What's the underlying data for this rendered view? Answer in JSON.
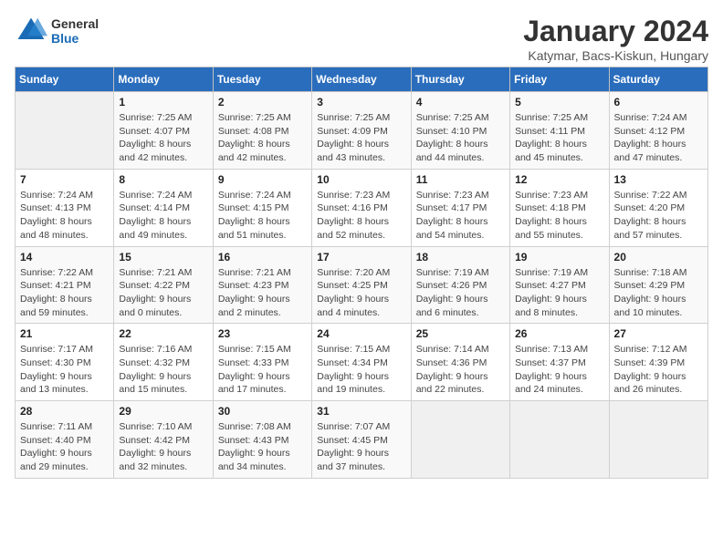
{
  "header": {
    "logo_general": "General",
    "logo_blue": "Blue",
    "main_title": "January 2024",
    "subtitle": "Katymar, Bacs-Kiskun, Hungary"
  },
  "weekdays": [
    "Sunday",
    "Monday",
    "Tuesday",
    "Wednesday",
    "Thursday",
    "Friday",
    "Saturday"
  ],
  "weeks": [
    [
      {
        "day": "",
        "sunrise": "",
        "sunset": "",
        "daylight": ""
      },
      {
        "day": "1",
        "sunrise": "Sunrise: 7:25 AM",
        "sunset": "Sunset: 4:07 PM",
        "daylight": "Daylight: 8 hours and 42 minutes."
      },
      {
        "day": "2",
        "sunrise": "Sunrise: 7:25 AM",
        "sunset": "Sunset: 4:08 PM",
        "daylight": "Daylight: 8 hours and 42 minutes."
      },
      {
        "day": "3",
        "sunrise": "Sunrise: 7:25 AM",
        "sunset": "Sunset: 4:09 PM",
        "daylight": "Daylight: 8 hours and 43 minutes."
      },
      {
        "day": "4",
        "sunrise": "Sunrise: 7:25 AM",
        "sunset": "Sunset: 4:10 PM",
        "daylight": "Daylight: 8 hours and 44 minutes."
      },
      {
        "day": "5",
        "sunrise": "Sunrise: 7:25 AM",
        "sunset": "Sunset: 4:11 PM",
        "daylight": "Daylight: 8 hours and 45 minutes."
      },
      {
        "day": "6",
        "sunrise": "Sunrise: 7:24 AM",
        "sunset": "Sunset: 4:12 PM",
        "daylight": "Daylight: 8 hours and 47 minutes."
      }
    ],
    [
      {
        "day": "7",
        "sunrise": "Sunrise: 7:24 AM",
        "sunset": "Sunset: 4:13 PM",
        "daylight": "Daylight: 8 hours and 48 minutes."
      },
      {
        "day": "8",
        "sunrise": "Sunrise: 7:24 AM",
        "sunset": "Sunset: 4:14 PM",
        "daylight": "Daylight: 8 hours and 49 minutes."
      },
      {
        "day": "9",
        "sunrise": "Sunrise: 7:24 AM",
        "sunset": "Sunset: 4:15 PM",
        "daylight": "Daylight: 8 hours and 51 minutes."
      },
      {
        "day": "10",
        "sunrise": "Sunrise: 7:23 AM",
        "sunset": "Sunset: 4:16 PM",
        "daylight": "Daylight: 8 hours and 52 minutes."
      },
      {
        "day": "11",
        "sunrise": "Sunrise: 7:23 AM",
        "sunset": "Sunset: 4:17 PM",
        "daylight": "Daylight: 8 hours and 54 minutes."
      },
      {
        "day": "12",
        "sunrise": "Sunrise: 7:23 AM",
        "sunset": "Sunset: 4:18 PM",
        "daylight": "Daylight: 8 hours and 55 minutes."
      },
      {
        "day": "13",
        "sunrise": "Sunrise: 7:22 AM",
        "sunset": "Sunset: 4:20 PM",
        "daylight": "Daylight: 8 hours and 57 minutes."
      }
    ],
    [
      {
        "day": "14",
        "sunrise": "Sunrise: 7:22 AM",
        "sunset": "Sunset: 4:21 PM",
        "daylight": "Daylight: 8 hours and 59 minutes."
      },
      {
        "day": "15",
        "sunrise": "Sunrise: 7:21 AM",
        "sunset": "Sunset: 4:22 PM",
        "daylight": "Daylight: 9 hours and 0 minutes."
      },
      {
        "day": "16",
        "sunrise": "Sunrise: 7:21 AM",
        "sunset": "Sunset: 4:23 PM",
        "daylight": "Daylight: 9 hours and 2 minutes."
      },
      {
        "day": "17",
        "sunrise": "Sunrise: 7:20 AM",
        "sunset": "Sunset: 4:25 PM",
        "daylight": "Daylight: 9 hours and 4 minutes."
      },
      {
        "day": "18",
        "sunrise": "Sunrise: 7:19 AM",
        "sunset": "Sunset: 4:26 PM",
        "daylight": "Daylight: 9 hours and 6 minutes."
      },
      {
        "day": "19",
        "sunrise": "Sunrise: 7:19 AM",
        "sunset": "Sunset: 4:27 PM",
        "daylight": "Daylight: 9 hours and 8 minutes."
      },
      {
        "day": "20",
        "sunrise": "Sunrise: 7:18 AM",
        "sunset": "Sunset: 4:29 PM",
        "daylight": "Daylight: 9 hours and 10 minutes."
      }
    ],
    [
      {
        "day": "21",
        "sunrise": "Sunrise: 7:17 AM",
        "sunset": "Sunset: 4:30 PM",
        "daylight": "Daylight: 9 hours and 13 minutes."
      },
      {
        "day": "22",
        "sunrise": "Sunrise: 7:16 AM",
        "sunset": "Sunset: 4:32 PM",
        "daylight": "Daylight: 9 hours and 15 minutes."
      },
      {
        "day": "23",
        "sunrise": "Sunrise: 7:15 AM",
        "sunset": "Sunset: 4:33 PM",
        "daylight": "Daylight: 9 hours and 17 minutes."
      },
      {
        "day": "24",
        "sunrise": "Sunrise: 7:15 AM",
        "sunset": "Sunset: 4:34 PM",
        "daylight": "Daylight: 9 hours and 19 minutes."
      },
      {
        "day": "25",
        "sunrise": "Sunrise: 7:14 AM",
        "sunset": "Sunset: 4:36 PM",
        "daylight": "Daylight: 9 hours and 22 minutes."
      },
      {
        "day": "26",
        "sunrise": "Sunrise: 7:13 AM",
        "sunset": "Sunset: 4:37 PM",
        "daylight": "Daylight: 9 hours and 24 minutes."
      },
      {
        "day": "27",
        "sunrise": "Sunrise: 7:12 AM",
        "sunset": "Sunset: 4:39 PM",
        "daylight": "Daylight: 9 hours and 26 minutes."
      }
    ],
    [
      {
        "day": "28",
        "sunrise": "Sunrise: 7:11 AM",
        "sunset": "Sunset: 4:40 PM",
        "daylight": "Daylight: 9 hours and 29 minutes."
      },
      {
        "day": "29",
        "sunrise": "Sunrise: 7:10 AM",
        "sunset": "Sunset: 4:42 PM",
        "daylight": "Daylight: 9 hours and 32 minutes."
      },
      {
        "day": "30",
        "sunrise": "Sunrise: 7:08 AM",
        "sunset": "Sunset: 4:43 PM",
        "daylight": "Daylight: 9 hours and 34 minutes."
      },
      {
        "day": "31",
        "sunrise": "Sunrise: 7:07 AM",
        "sunset": "Sunset: 4:45 PM",
        "daylight": "Daylight: 9 hours and 37 minutes."
      },
      {
        "day": "",
        "sunrise": "",
        "sunset": "",
        "daylight": ""
      },
      {
        "day": "",
        "sunrise": "",
        "sunset": "",
        "daylight": ""
      },
      {
        "day": "",
        "sunrise": "",
        "sunset": "",
        "daylight": ""
      }
    ]
  ]
}
